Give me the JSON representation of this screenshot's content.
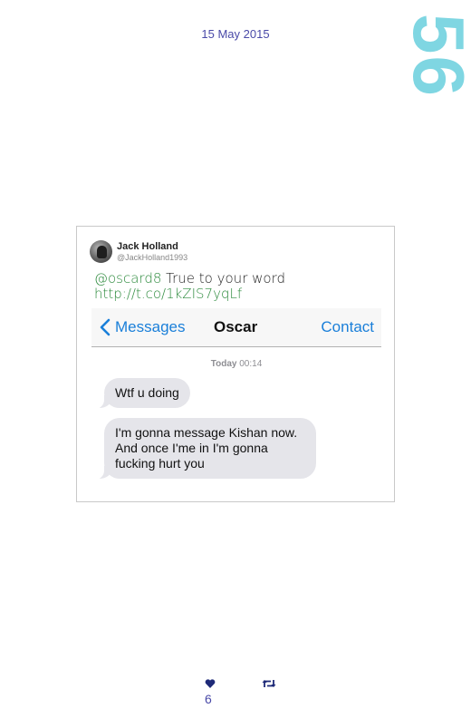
{
  "header": {
    "date": "15 May 2015",
    "page_number": "56"
  },
  "tweet": {
    "author_name": "Jack Holland",
    "author_handle": "@JackHolland1993",
    "mention": "@oscard8",
    "text": " True to your word",
    "link": "http://t.co/1kZIS7yqLf",
    "screenshot": {
      "back_label": "Messages",
      "title": "Oscar",
      "contact_label": "Contact",
      "timestamp_day": "Today",
      "timestamp_time": "00:14",
      "messages": [
        {
          "text": "Wtf u doing"
        },
        {
          "text": "I'm gonna message Kishan now. And once I'me in I'm gonna fucking hurt you"
        }
      ]
    }
  },
  "footer": {
    "like_count": "6",
    "icons": [
      "heart-icon",
      "retweet-icon"
    ]
  },
  "colors": {
    "page_number": "#7fd6e2",
    "date": "#4a4aa8",
    "link": "#2e8b3e",
    "ios_blue": "#1a7fd9",
    "bubble": "#e5e5ea"
  }
}
